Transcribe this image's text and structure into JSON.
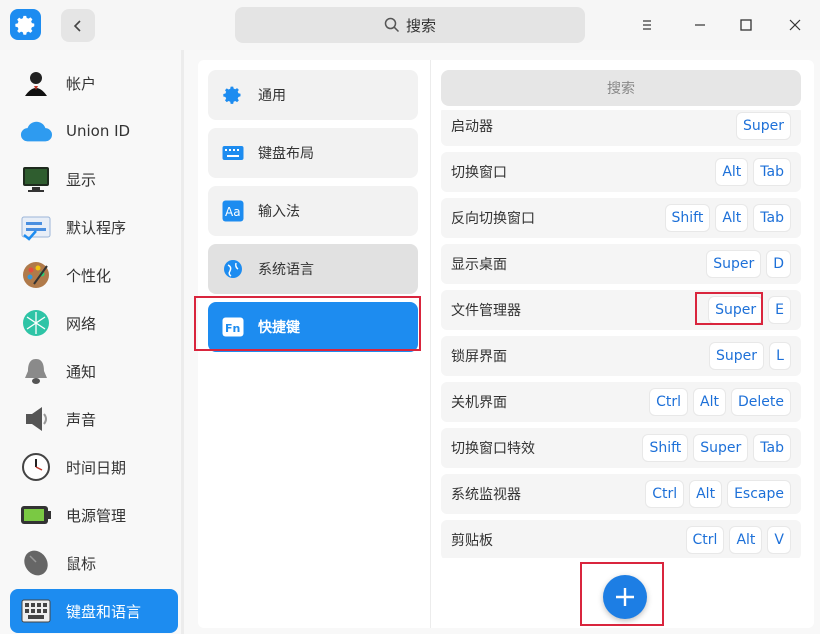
{
  "titlebar": {
    "search_label": "搜索",
    "icons": [
      "settings-app-icon",
      "back-icon",
      "search-icon",
      "menu-icon",
      "minimize-icon",
      "maximize-icon",
      "close-icon"
    ]
  },
  "sidebar": {
    "items": [
      {
        "label": "帐户",
        "icon": "account-icon"
      },
      {
        "label": "Union ID",
        "icon": "cloud-icon"
      },
      {
        "label": "显示",
        "icon": "display-icon"
      },
      {
        "label": "默认程序",
        "icon": "default-apps-icon"
      },
      {
        "label": "个性化",
        "icon": "personalization-icon"
      },
      {
        "label": "网络",
        "icon": "network-icon"
      },
      {
        "label": "通知",
        "icon": "bell-icon"
      },
      {
        "label": "声音",
        "icon": "speaker-icon"
      },
      {
        "label": "时间日期",
        "icon": "clock-icon"
      },
      {
        "label": "电源管理",
        "icon": "battery-icon"
      },
      {
        "label": "鼠标",
        "icon": "mouse-icon"
      },
      {
        "label": "键盘和语言",
        "icon": "keyboard-icon"
      }
    ],
    "active_index": 11
  },
  "middle": {
    "items": [
      {
        "label": "通用",
        "icon": "gear-icon"
      },
      {
        "label": "键盘布局",
        "icon": "keyboard-layout-icon"
      },
      {
        "label": "输入法",
        "icon": "input-method-icon"
      },
      {
        "label": "系统语言",
        "icon": "globe-icon"
      },
      {
        "label": "快捷键",
        "icon": "fn-key-icon"
      }
    ],
    "active_index": 4
  },
  "shortcuts": {
    "search_placeholder": "搜索",
    "rows": [
      {
        "name": "启动器",
        "keys": [
          "Super"
        ]
      },
      {
        "name": "切换窗口",
        "keys": [
          "Alt",
          "Tab"
        ]
      },
      {
        "name": "反向切换窗口",
        "keys": [
          "Shift",
          "Alt",
          "Tab"
        ]
      },
      {
        "name": "显示桌面",
        "keys": [
          "Super",
          "D"
        ]
      },
      {
        "name": "文件管理器",
        "keys": [
          "Super",
          "E"
        ]
      },
      {
        "name": "锁屏界面",
        "keys": [
          "Super",
          "L"
        ]
      },
      {
        "name": "关机界面",
        "keys": [
          "Ctrl",
          "Alt",
          "Delete"
        ]
      },
      {
        "name": "切换窗口特效",
        "keys": [
          "Shift",
          "Super",
          "Tab"
        ]
      },
      {
        "name": "系统监视器",
        "keys": [
          "Ctrl",
          "Alt",
          "Escape"
        ]
      },
      {
        "name": "剪贴板",
        "keys": [
          "Ctrl",
          "Alt",
          "V"
        ]
      }
    ],
    "add_button_icon": "plus-icon"
  },
  "colors": {
    "accent": "#1d8cf0",
    "highlight": "#d9253d",
    "key_text": "#1d70d8"
  }
}
